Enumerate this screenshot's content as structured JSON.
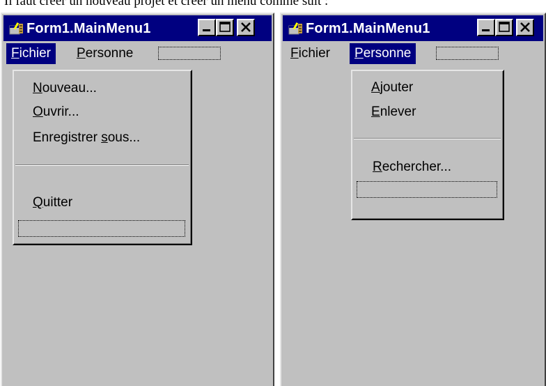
{
  "caption": "Il faut créer un nouveau projet et créer un menu comme suit :",
  "colors": {
    "face": "#c0c0c0",
    "title_bar": "#000080",
    "highlight_text": "#ffffff"
  },
  "windows": [
    {
      "title": "Form1.MainMenu1",
      "menu": [
        {
          "label": "Fichier",
          "accel": "F",
          "rest": "ichier",
          "active": true
        },
        {
          "label": "Personne",
          "accel": "P",
          "rest": "ersonne",
          "active": false
        }
      ],
      "dropdown": [
        {
          "accel": "N",
          "rest": "ouveau..."
        },
        {
          "accel": "O",
          "rest": "uvrir..."
        },
        {
          "pre": "Enregistrer ",
          "accel": "s",
          "rest": "ous..."
        },
        {
          "accel": "Q",
          "rest": "uitter"
        }
      ]
    },
    {
      "title": "Form1.MainMenu1",
      "menu": [
        {
          "label": "Fichier",
          "accel": "F",
          "rest": "ichier",
          "active": false
        },
        {
          "label": "Personne",
          "accel": "P",
          "rest": "ersonne",
          "active": true
        }
      ],
      "dropdown": [
        {
          "accel": "A",
          "rest": "jouter"
        },
        {
          "accel": "E",
          "rest": "nlever"
        },
        {
          "accel": "R",
          "rest": "echercher..."
        }
      ]
    }
  ],
  "icons": {
    "app": "form-app-icon",
    "minimize": "minimize-icon",
    "maximize": "maximize-icon",
    "close": "close-icon"
  }
}
